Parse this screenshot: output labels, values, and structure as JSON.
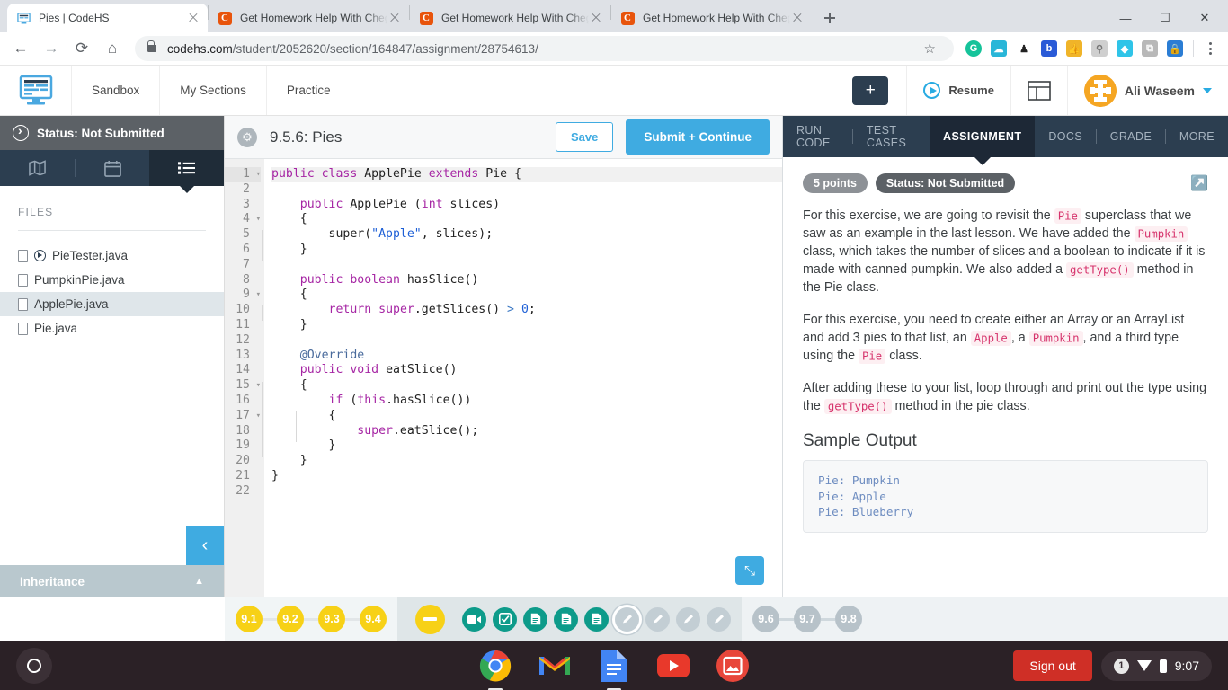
{
  "browser": {
    "tabs": [
      {
        "title": "Pies | CodeHS",
        "favicon": "codehs-icon",
        "active": true
      },
      {
        "title": "Get Homework Help With Chegg",
        "favicon": "chegg-icon",
        "active": false
      },
      {
        "title": "Get Homework Help With Chegg",
        "favicon": "chegg-icon",
        "active": false
      },
      {
        "title": "Get Homework Help With Chegg",
        "favicon": "chegg-icon",
        "active": false
      }
    ],
    "new_tab_label": "+",
    "window_controls": [
      "minimize",
      "restore",
      "close"
    ],
    "url_host": "codehs.com",
    "url_path": "/student/2052620/section/164847/assignment/28754613/",
    "extensions": [
      {
        "name": "grammarly-extension",
        "glyph": "G",
        "color": "#15c39a"
      },
      {
        "name": "cloud-extension",
        "glyph": "☁",
        "color": "#29b6d8"
      },
      {
        "name": "penguin-extension",
        "glyph": "♟",
        "color": "#ffffff"
      },
      {
        "name": "bitly-extension",
        "glyph": "b",
        "color": "#2a5bd7"
      },
      {
        "name": "thumbs-up-extension",
        "glyph": "👍",
        "color": "#f0b429"
      },
      {
        "name": "gorilla-extension",
        "glyph": "⛊",
        "color": "#cfcfcf"
      },
      {
        "name": "diamond-extension",
        "glyph": "◆",
        "color": "#2fc4e8"
      },
      {
        "name": "copy-extension",
        "glyph": "⧉",
        "color": "#b8b8b8"
      },
      {
        "name": "lock-extension",
        "glyph": "🔒",
        "color": "#2b7dd4"
      }
    ]
  },
  "site_nav": {
    "logo": "codehs-logo",
    "links": [
      "Sandbox",
      "My Sections",
      "Practice"
    ],
    "add_label": "+",
    "resume_label": "Resume",
    "layout_icon": "layout-icon",
    "user_name": "Ali Waseem"
  },
  "sidebar": {
    "status_text": "Status: Not Submitted",
    "tabs": [
      {
        "name": "map-icon",
        "active": false
      },
      {
        "name": "calendar-icon",
        "active": false
      },
      {
        "name": "list-icon",
        "active": true
      }
    ],
    "files_header": "FILES",
    "files": [
      {
        "name": "PieTester.java",
        "runnable": true,
        "active": false
      },
      {
        "name": "PumpkinPie.java",
        "runnable": false,
        "active": false
      },
      {
        "name": "ApplePie.java",
        "runnable": false,
        "active": true
      },
      {
        "name": "Pie.java",
        "runnable": false,
        "active": false
      }
    ],
    "collapse_label": "‹",
    "section_label": "Inheritance",
    "section_chevron": "ⱏ"
  },
  "editor": {
    "gear_icon": "gear-icon",
    "title": "9.5.6: Pies",
    "save_label": "Save",
    "submit_label": "Submit + Continue",
    "expand_label": "⤡",
    "line_count": 22,
    "fold_lines": [
      1,
      4,
      9,
      15,
      17
    ],
    "code_lines": [
      "public class ApplePie extends Pie {",
      "",
      "    public ApplePie (int slices)",
      "    {",
      "        super(\"Apple\", slices);",
      "    }",
      "",
      "    public boolean hasSlice()",
      "    {",
      "        return super.getSlices() > 0;",
      "    }",
      "",
      "    @Override",
      "    public void eatSlice()",
      "    {",
      "        if (this.hasSlice())",
      "        {",
      "            super.eatSlice();",
      "        }",
      "    }",
      "}",
      ""
    ]
  },
  "right_panel": {
    "tabs": [
      {
        "label": "RUN CODE",
        "active": false
      },
      {
        "label": "TEST CASES",
        "active": false
      },
      {
        "label": "ASSIGNMENT",
        "active": true
      },
      {
        "label": "DOCS",
        "active": false
      },
      {
        "label": "GRADE",
        "active": false
      },
      {
        "label": "MORE",
        "active": false
      }
    ],
    "points_badge": "5 points",
    "status_badge": "Status: Not Submitted",
    "popout_icon": "open-in-new-icon",
    "paragraph1": {
      "a": "For this exercise, we are going to revisit the ",
      "code1": "Pie",
      "b": " superclass that we saw as an example in the last lesson. We have added the ",
      "code2": "Pumpkin",
      "c": " class, which takes the number of slices and a boolean to indicate if it is made with canned pumpkin. We also added a ",
      "code3": "getType()",
      "d": " method in the Pie class."
    },
    "paragraph2": {
      "a": "For this exercise, you need to create either an Array or an ArrayList and add 3 pies to that list, an ",
      "code1": "Apple",
      "b": ", a ",
      "code2": "Pumpkin",
      "c": ", and a third type using the ",
      "code3": "Pie",
      "d": " class."
    },
    "paragraph3": {
      "a": "After adding these to your list, loop through and print out the type using the ",
      "code1": "getType()",
      "b": " method in the pie class."
    },
    "sample_heading": "Sample Output",
    "sample_output": "Pie: Pumpkin\nPie: Apple\nPie: Blueberry"
  },
  "progress": {
    "group_a": [
      "9.1",
      "9.2",
      "9.3",
      "9.4"
    ],
    "minus_label": "minus-icon",
    "activity_icons": [
      {
        "name": "video-icon",
        "glyph": "▶",
        "state": "done"
      },
      {
        "name": "quiz-check-icon",
        "glyph": "✓",
        "state": "done"
      },
      {
        "name": "document-icon",
        "glyph": "☰",
        "state": "done"
      },
      {
        "name": "document-icon",
        "glyph": "☰",
        "state": "done"
      },
      {
        "name": "document-icon",
        "glyph": "☰",
        "state": "done"
      },
      {
        "name": "pencil-icon",
        "glyph": "✎",
        "state": "current"
      },
      {
        "name": "pencil-icon",
        "glyph": "✎",
        "state": "todo"
      },
      {
        "name": "pencil-icon",
        "glyph": "✎",
        "state": "todo"
      },
      {
        "name": "pencil-icon",
        "glyph": "✎",
        "state": "todo"
      }
    ],
    "group_c": [
      "9.6",
      "9.7",
      "9.8"
    ]
  },
  "shelf": {
    "launcher": "launcher-icon",
    "apps": [
      {
        "name": "chrome-icon",
        "open": true
      },
      {
        "name": "gmail-icon",
        "open": false
      },
      {
        "name": "google-docs-icon",
        "open": true
      },
      {
        "name": "youtube-icon",
        "open": false
      },
      {
        "name": "photos-icon",
        "open": false
      }
    ],
    "sign_out_label": "Sign out",
    "notification_count": "1",
    "clock": "9:07"
  },
  "colors": {
    "accent_blue": "#3fabe1",
    "nav_dark": "#2c3e50",
    "progress_yellow": "#f7d117",
    "progress_teal": "#0d9b8a",
    "code_string": "#1d5fd6",
    "code_keyword": "#a626a4",
    "inline_code": "#d6336c"
  }
}
